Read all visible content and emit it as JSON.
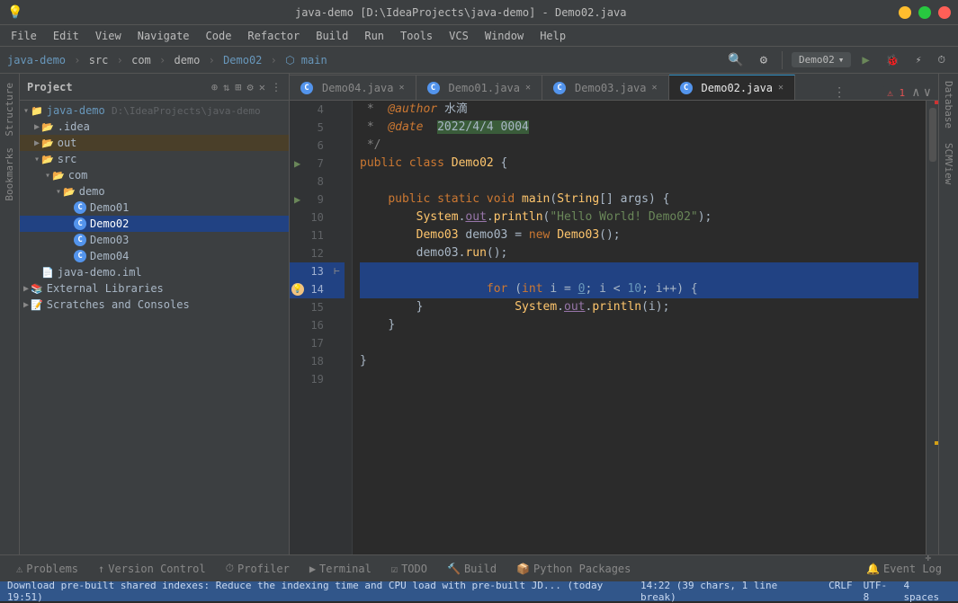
{
  "titlebar": {
    "title": "java-demo [D:\\IdeaProjects\\java-demo] - Demo02.java",
    "app": "java-demo"
  },
  "menubar": {
    "items": [
      "File",
      "Edit",
      "View",
      "Navigate",
      "Code",
      "Refactor",
      "Build",
      "Run",
      "Tools",
      "VCS",
      "Window",
      "Help"
    ]
  },
  "breadcrumb": {
    "parts": [
      "java-demo",
      "src",
      "com",
      "demo",
      "Demo02",
      "main"
    ]
  },
  "tabs": [
    {
      "label": "Demo04.java",
      "active": false
    },
    {
      "label": "Demo01.java",
      "active": false
    },
    {
      "label": "Demo03.java",
      "active": false
    },
    {
      "label": "Demo02.java",
      "active": true
    }
  ],
  "run_config": "Demo02",
  "sidebar": {
    "title": "Project",
    "tree": [
      {
        "indent": 0,
        "type": "project",
        "label": "java-demo",
        "path": "D:\\IdeaProjects\\java-demo",
        "expanded": true
      },
      {
        "indent": 1,
        "type": "folder",
        "label": ".idea",
        "expanded": false
      },
      {
        "indent": 1,
        "type": "folder",
        "label": "out",
        "expanded": false,
        "selected": false,
        "highlighted": true
      },
      {
        "indent": 1,
        "type": "folder",
        "label": "src",
        "expanded": true
      },
      {
        "indent": 2,
        "type": "folder",
        "label": "com",
        "expanded": true
      },
      {
        "indent": 3,
        "type": "folder",
        "label": "demo",
        "expanded": true
      },
      {
        "indent": 4,
        "type": "java",
        "label": "Demo01"
      },
      {
        "indent": 4,
        "type": "java",
        "label": "Demo02",
        "selected": true
      },
      {
        "indent": 4,
        "type": "java",
        "label": "Demo03"
      },
      {
        "indent": 4,
        "type": "java",
        "label": "Demo04"
      },
      {
        "indent": 1,
        "type": "file",
        "label": "java-demo.iml"
      },
      {
        "indent": 0,
        "type": "folder",
        "label": "External Libraries",
        "expanded": false
      },
      {
        "indent": 0,
        "type": "folder",
        "label": "Scratches and Consoles",
        "expanded": false
      }
    ]
  },
  "code": {
    "lines": [
      {
        "num": 4,
        "content": " *  @author 水滴",
        "type": "comment_author"
      },
      {
        "num": 5,
        "content": " *  @date  2022/4/4 0004",
        "type": "comment_date"
      },
      {
        "num": 6,
        "content": " */",
        "type": "comment"
      },
      {
        "num": 7,
        "content": "public class Demo02 {",
        "type": "class_decl",
        "arrow": true
      },
      {
        "num": 8,
        "content": "",
        "type": "empty"
      },
      {
        "num": 9,
        "content": "    public static void main(String[] args) {",
        "type": "method_decl",
        "arrow": true
      },
      {
        "num": 10,
        "content": "        System.out.println(\"Hello World! Demo02\");",
        "type": "code"
      },
      {
        "num": 11,
        "content": "        Demo03 demo03 = new Demo03();",
        "type": "code"
      },
      {
        "num": 12,
        "content": "        demo03.run();",
        "type": "code"
      },
      {
        "num": 13,
        "content": "        for (int i = 0; i < 10; i++) {",
        "type": "code",
        "highlighted": true,
        "bookmark": true
      },
      {
        "num": 14,
        "content": "            System.out.println(i);",
        "type": "code",
        "highlighted": true,
        "hint": true
      },
      {
        "num": 15,
        "content": "        }",
        "type": "code"
      },
      {
        "num": 16,
        "content": "    }",
        "type": "code"
      },
      {
        "num": 17,
        "content": "",
        "type": "empty"
      },
      {
        "num": 18,
        "content": "}",
        "type": "code"
      },
      {
        "num": 19,
        "content": "",
        "type": "empty"
      }
    ]
  },
  "status": {
    "position": "14:22 (39 chars, 1 line break)",
    "line_ending": "CRLF",
    "encoding": "UTF-8",
    "indent": "4 spaces"
  },
  "bottom_tabs": [
    {
      "label": "Problems",
      "icon": "⚠"
    },
    {
      "label": "Version Control",
      "icon": "↑"
    },
    {
      "label": "Profiler",
      "icon": "⏱",
      "active": false
    },
    {
      "label": "Terminal",
      "icon": "▶"
    },
    {
      "label": "TODO",
      "icon": "☑"
    },
    {
      "label": "Build",
      "icon": "🔨"
    },
    {
      "label": "Python Packages",
      "icon": "📦"
    }
  ],
  "bottom_right_tabs": [
    {
      "label": "Event Log",
      "icon": "📋"
    }
  ],
  "info_bar": {
    "text": "Download pre-built shared indexes: Reduce the indexing time and CPU load with pre-built JD... (today 19:51)"
  },
  "right_tabs": [
    "Database",
    "SCMView"
  ],
  "left_tabs": [
    "Structure",
    "Bookmarks"
  ],
  "errors": {
    "count": "1",
    "label": "A1"
  }
}
